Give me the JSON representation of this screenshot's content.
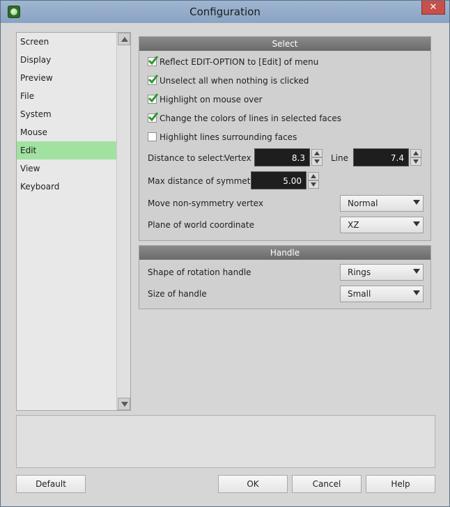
{
  "window": {
    "title": "Configuration",
    "close_label": "✕"
  },
  "sidebar": {
    "items": [
      {
        "label": "Screen"
      },
      {
        "label": "Display"
      },
      {
        "label": "Preview"
      },
      {
        "label": "File"
      },
      {
        "label": "System"
      },
      {
        "label": "Mouse"
      },
      {
        "label": "Edit"
      },
      {
        "label": "View"
      },
      {
        "label": "Keyboard"
      }
    ],
    "selected": "Edit"
  },
  "select_group": {
    "header": "Select",
    "checkboxes": [
      {
        "label": "Reflect EDIT-OPTION to [Edit] of menu",
        "checked": true
      },
      {
        "label": "Unselect all when nothing is clicked",
        "checked": true
      },
      {
        "label": "Highlight on mouse over",
        "checked": true
      },
      {
        "label": "Change the colors of lines in selected faces",
        "checked": true
      },
      {
        "label": "Highlight lines surrounding faces",
        "checked": false
      }
    ],
    "distance_label": "Distance to select:",
    "vertex_label": "Vertex",
    "vertex_value": "8.3",
    "line_label": "Line",
    "line_value": "7.4",
    "max_sym_label": "Max distance of symmetry",
    "max_sym_value": "5.00",
    "move_nonsym_label": "Move non-symmetry vertex",
    "move_nonsym_value": "Normal",
    "plane_label": "Plane of world coordinate",
    "plane_value": "XZ"
  },
  "handle_group": {
    "header": "Handle",
    "shape_label": "Shape of rotation handle",
    "shape_value": "Rings",
    "size_label": "Size of handle",
    "size_value": "Small"
  },
  "buttons": {
    "default": "Default",
    "ok": "OK",
    "cancel": "Cancel",
    "help": "Help"
  },
  "colors": {
    "selected_item": "#a1e2a1",
    "check_green": "#2a9a2a",
    "header_gray": "#7a7a7a"
  }
}
